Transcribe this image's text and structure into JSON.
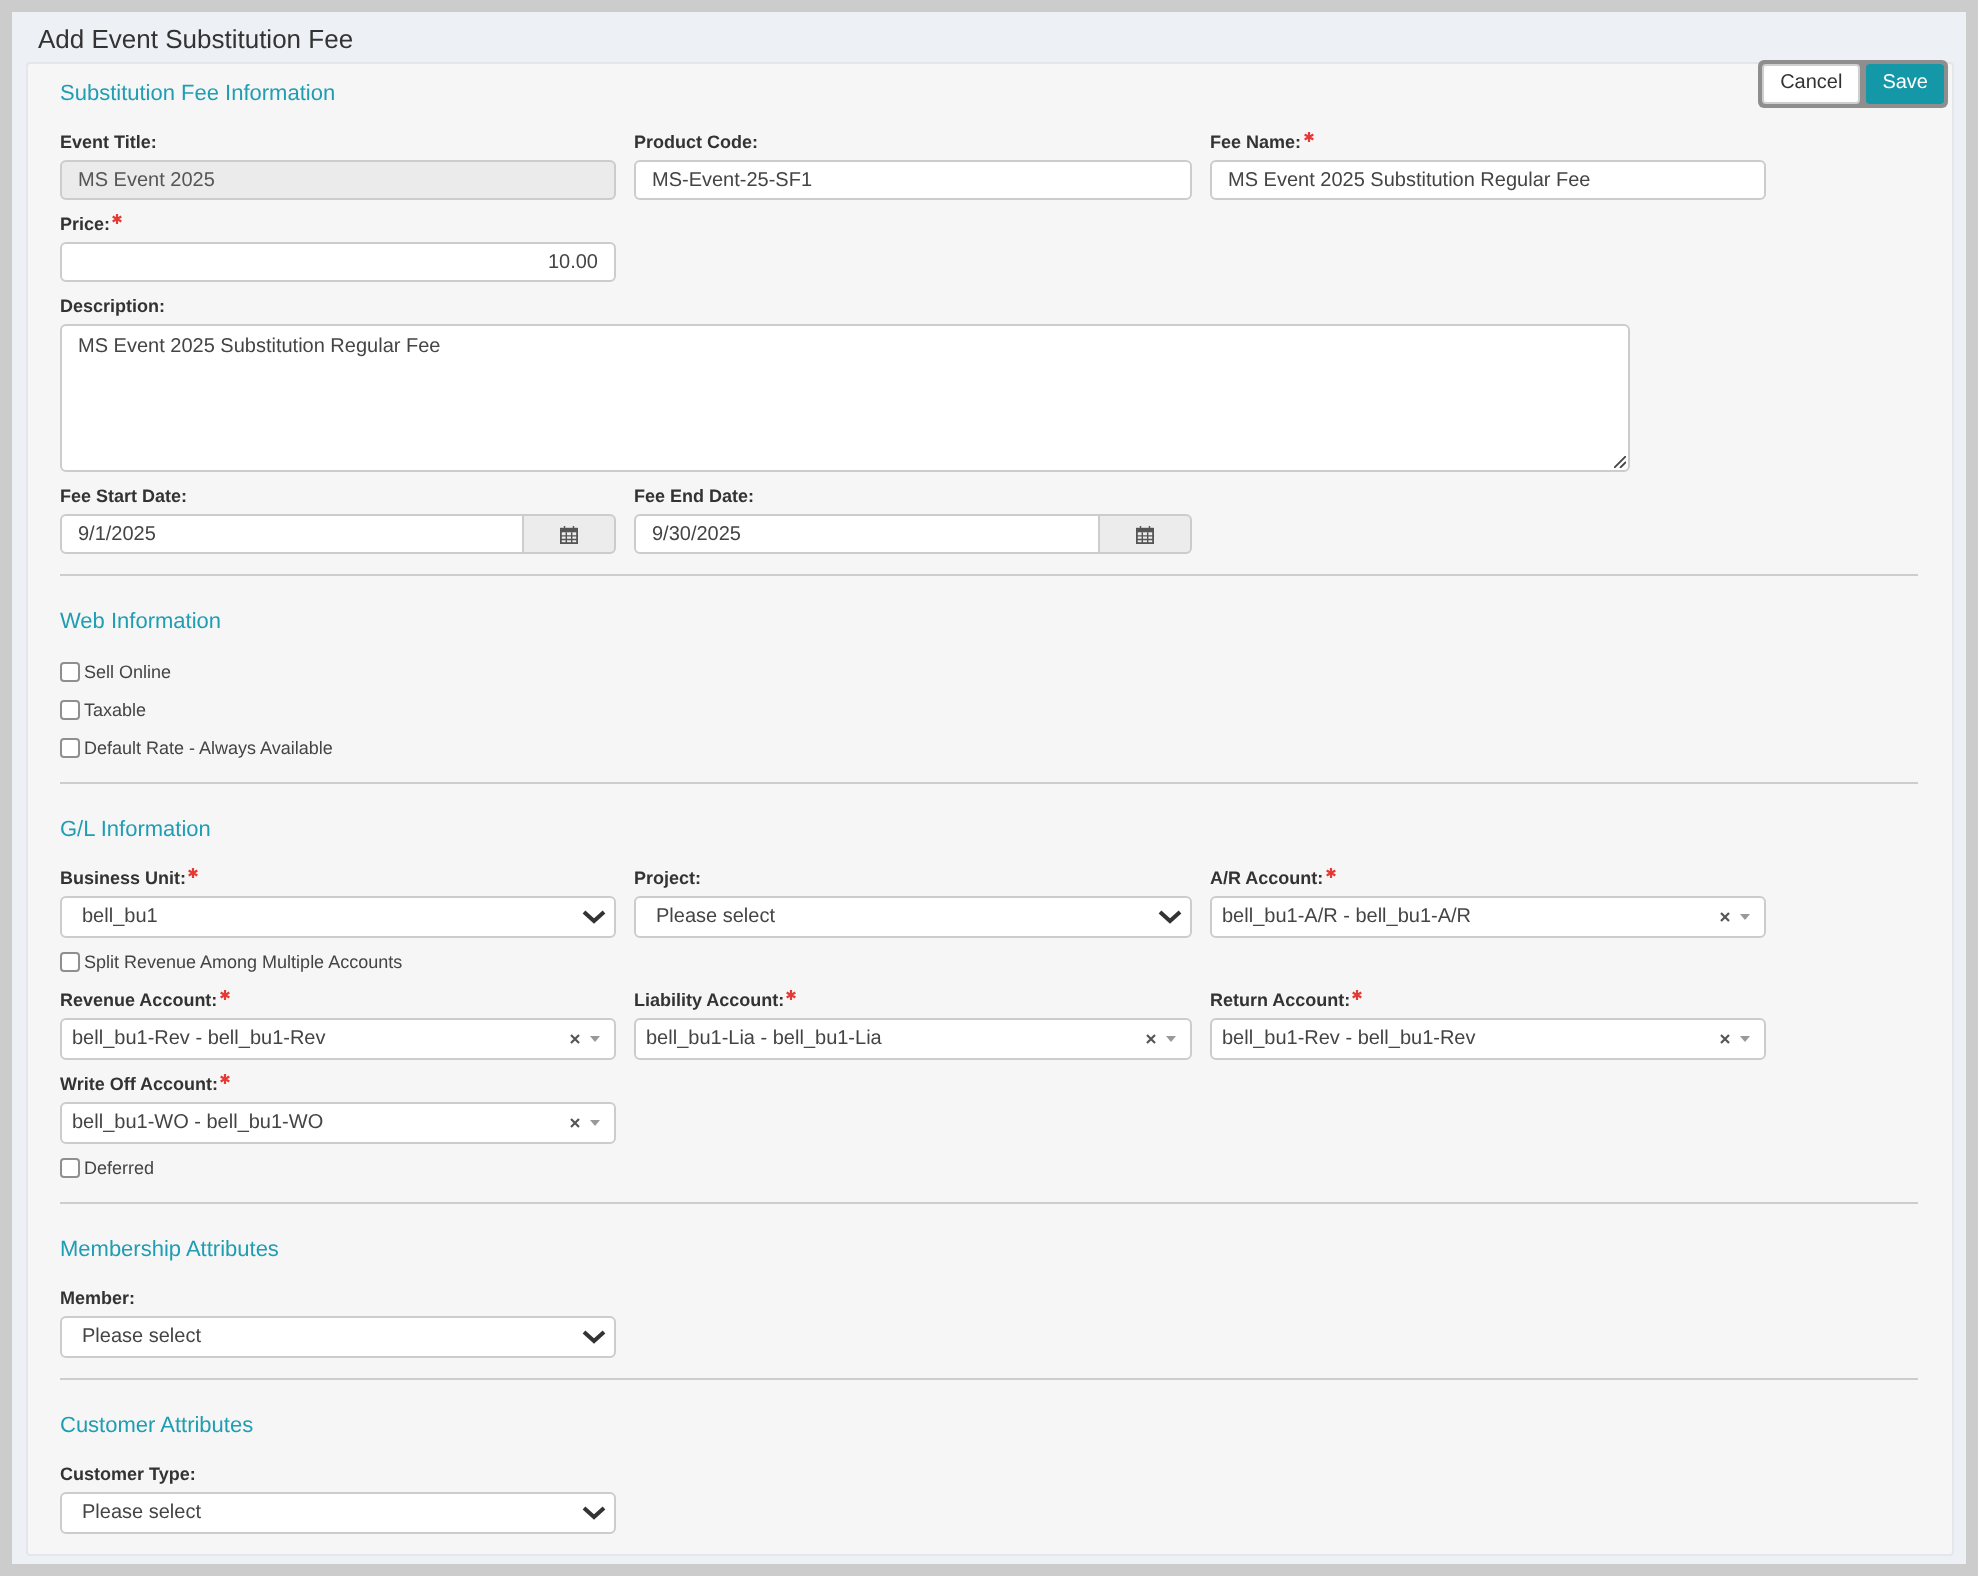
{
  "window": {
    "title": "Add Event Substitution Fee"
  },
  "actions": [
    {
      "label": "Cancel",
      "kind": "secondary"
    },
    {
      "label": "Save",
      "kind": "primary"
    }
  ],
  "sections": [
    {
      "title": "Substitution Fee Information",
      "rows": [
        [
          {
            "kind": "text",
            "label": "Event Title:",
            "value": "MS Event 2025",
            "required": false,
            "disabled": true
          },
          {
            "kind": "text",
            "label": "Product Code:",
            "value": "MS-Event-25-SF1",
            "required": false,
            "disabled": false
          },
          {
            "kind": "text",
            "label": "Fee Name:",
            "value": "MS Event 2025 Substitution Regular Fee",
            "required": true,
            "disabled": false
          }
        ],
        [
          {
            "kind": "number",
            "label": "Price:",
            "value": "10.00",
            "required": true,
            "disabled": false
          }
        ],
        [
          {
            "kind": "textarea",
            "label": "Description:",
            "value": "MS Event 2025 Substitution Regular Fee",
            "required": false,
            "disabled": false
          }
        ],
        [
          {
            "kind": "date",
            "label": "Fee Start Date:",
            "value": "9/1/2025",
            "required": false,
            "disabled": false
          },
          {
            "kind": "date",
            "label": "Fee End Date:",
            "value": "9/30/2025",
            "required": false,
            "disabled": false
          }
        ]
      ]
    },
    {
      "title": "Web Information",
      "rows": [
        [
          {
            "kind": "checkbox",
            "label": "Sell Online",
            "checked": false
          }
        ],
        [
          {
            "kind": "checkbox",
            "label": "Taxable",
            "checked": false
          }
        ],
        [
          {
            "kind": "checkbox",
            "label": "Default Rate - Always Available",
            "checked": false
          }
        ]
      ]
    },
    {
      "title": "G/L Information",
      "rows": [
        [
          {
            "kind": "select",
            "label": "Business Unit:",
            "value": "bell_bu1",
            "required": true,
            "disabled": false
          },
          {
            "kind": "select",
            "label": "Project:",
            "value": "Please select",
            "required": false,
            "disabled": false
          },
          {
            "kind": "combo",
            "label": "A/R Account:",
            "value": "bell_bu1-A/R - bell_bu1-A/R",
            "required": true,
            "disabled": false
          }
        ],
        [
          {
            "kind": "checkbox",
            "label": "Split Revenue Among Multiple Accounts",
            "checked": false
          }
        ],
        [
          {
            "kind": "combo",
            "label": "Revenue Account:",
            "value": "bell_bu1-Rev - bell_bu1-Rev",
            "required": true,
            "disabled": false
          },
          {
            "kind": "combo",
            "label": "Liability Account:",
            "value": "bell_bu1-Lia - bell_bu1-Lia",
            "required": true,
            "disabled": false
          },
          {
            "kind": "combo",
            "label": "Return Account:",
            "value": "bell_bu1-Rev - bell_bu1-Rev",
            "required": true,
            "disabled": false
          }
        ],
        [
          {
            "kind": "combo",
            "label": "Write Off Account:",
            "value": "bell_bu1-WO - bell_bu1-WO",
            "required": true,
            "disabled": false
          }
        ],
        [
          {
            "kind": "checkbox",
            "label": "Deferred",
            "checked": false
          }
        ]
      ]
    },
    {
      "title": "Membership Attributes",
      "rows": [
        [
          {
            "kind": "select",
            "label": "Member:",
            "value": "Please select",
            "required": false,
            "disabled": false
          }
        ]
      ]
    },
    {
      "title": "Customer Attributes",
      "rows": [
        [
          {
            "kind": "select",
            "label": "Customer Type:",
            "value": "Please select",
            "required": false,
            "disabled": false
          }
        ]
      ]
    }
  ]
}
